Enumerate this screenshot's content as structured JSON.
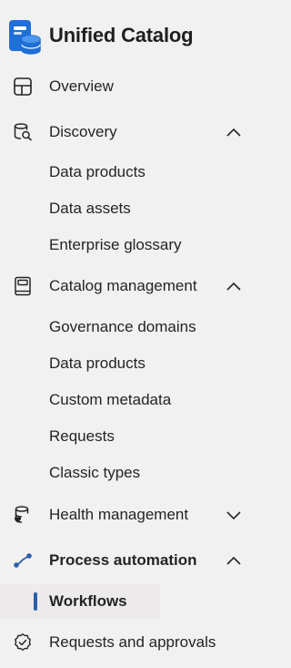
{
  "app": {
    "title": "Unified Catalog",
    "logo_icon": "unified-catalog-logo-icon"
  },
  "colors": {
    "background": "#f2f1f1",
    "accent": "#2d5fa8",
    "logo_blue": "#1f6fd6",
    "text": "#242424"
  },
  "nav": {
    "overview": {
      "label": "Overview",
      "icon": "table-grid-icon"
    },
    "discovery": {
      "label": "Discovery",
      "icon": "database-search-icon",
      "expanded": true,
      "items": [
        "Data products",
        "Data assets",
        "Enterprise glossary"
      ]
    },
    "catalog_management": {
      "label": "Catalog management",
      "icon": "book-icon",
      "expanded": true,
      "items": [
        "Governance domains",
        "Data products",
        "Custom metadata",
        "Requests",
        "Classic types"
      ]
    },
    "health_management": {
      "label": "Health management",
      "icon": "database-heart-icon",
      "expanded": false
    },
    "process_automation": {
      "label": "Process automation",
      "icon": "flow-icon",
      "expanded": true,
      "items": [
        "Workflows"
      ],
      "selected_item": "Workflows"
    },
    "requests_approvals": {
      "label": "Requests and approvals",
      "icon": "badge-check-icon"
    }
  }
}
